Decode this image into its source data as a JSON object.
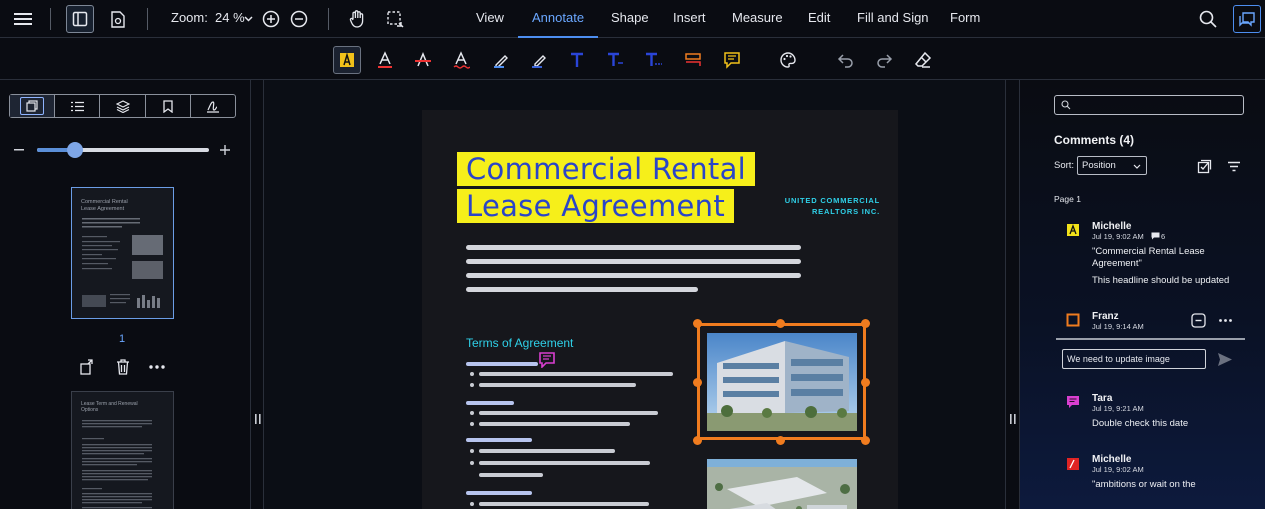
{
  "header": {
    "zoom_label": "Zoom:",
    "zoom_value": "24 %",
    "tabs": [
      {
        "label": "View"
      },
      {
        "label": "Annotate"
      },
      {
        "label": "Shape"
      },
      {
        "label": "Insert"
      },
      {
        "label": "Measure"
      },
      {
        "label": "Edit"
      },
      {
        "label": "Fill and Sign"
      },
      {
        "label": "Form"
      }
    ],
    "active_tab": "Annotate"
  },
  "toolbar": {
    "tools": [
      "area-highlight-icon",
      "text-color-icon",
      "strikeout-icon",
      "underline-icon",
      "freehand-highlight-icon",
      "highlighter-icon",
      "free-text-icon",
      "callout-text-icon",
      "text-box-icon",
      "replace-text-icon",
      "note-icon",
      "palette-icon",
      "undo-icon",
      "redo-icon",
      "eraser-icon"
    ]
  },
  "left_panel": {
    "slider_value": 0.22,
    "page_number": "1",
    "thumb1": {
      "title": "Commercial Rental\nLease Agreement"
    },
    "thumb2": {
      "title": "Lease Term and Renewal\nOptions"
    }
  },
  "document": {
    "title_line1": "Commercial Rental",
    "title_line2": "Lease Agreement",
    "company_line1": "UNITED COMMERCIAL",
    "company_line2": "REALTORS INC.",
    "section_heading": "Terms of Agreement"
  },
  "comments_panel": {
    "title": "Comments (4)",
    "sort_label": "Sort:",
    "sort_value": "Position",
    "page_label": "Page 1",
    "comments": [
      {
        "author": "Michelle",
        "time": "Jul 19, 9:02 AM",
        "reply_count": "6",
        "quote": "\"Commercial Rental Lease Agreement\"",
        "text": "This headline should be updated",
        "color": "#f2e21a"
      },
      {
        "author": "Franz",
        "time": "Jul 19, 9:14 AM",
        "reply_input": "We need to update image",
        "color": "#f07c1f"
      },
      {
        "author": "Tara",
        "time": "Jul 19, 9:21 AM",
        "text": "Double check this date",
        "color": "#d93fd0"
      },
      {
        "author": "Michelle",
        "time": "Jul 19, 9:02 AM",
        "text": "\"ambitions or wait on the",
        "color": "#e02424"
      }
    ]
  },
  "colors": {
    "accent": "#4d8ef0",
    "highlight": "#f6ef1a",
    "selection": "#f07c1f",
    "heading_cyan": "#2fd0e8"
  }
}
